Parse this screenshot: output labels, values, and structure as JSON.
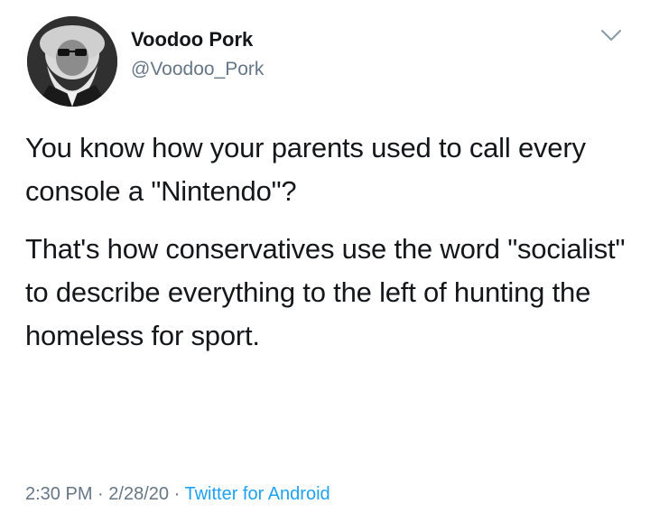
{
  "tweet": {
    "author": {
      "display_name": "Voodoo Pork",
      "handle": "@Voodoo_Pork",
      "avatar": "bearded-man-with-sunglasses-portrait"
    },
    "menu_icon": "chevron-down-icon",
    "paragraphs": [
      "You know how your parents used to call every console a \"Nintendo\"?",
      "That's how conservatives use the word \"socialist\" to describe everything to the left of hunting the homeless for sport."
    ],
    "meta": {
      "time": "2:30 PM",
      "separator": "·",
      "date": "2/28/20",
      "source": "Twitter for Android"
    }
  },
  "colors": {
    "text": "#14171a",
    "secondary": "#657786",
    "link": "#1da1f2",
    "background": "#ffffff"
  }
}
